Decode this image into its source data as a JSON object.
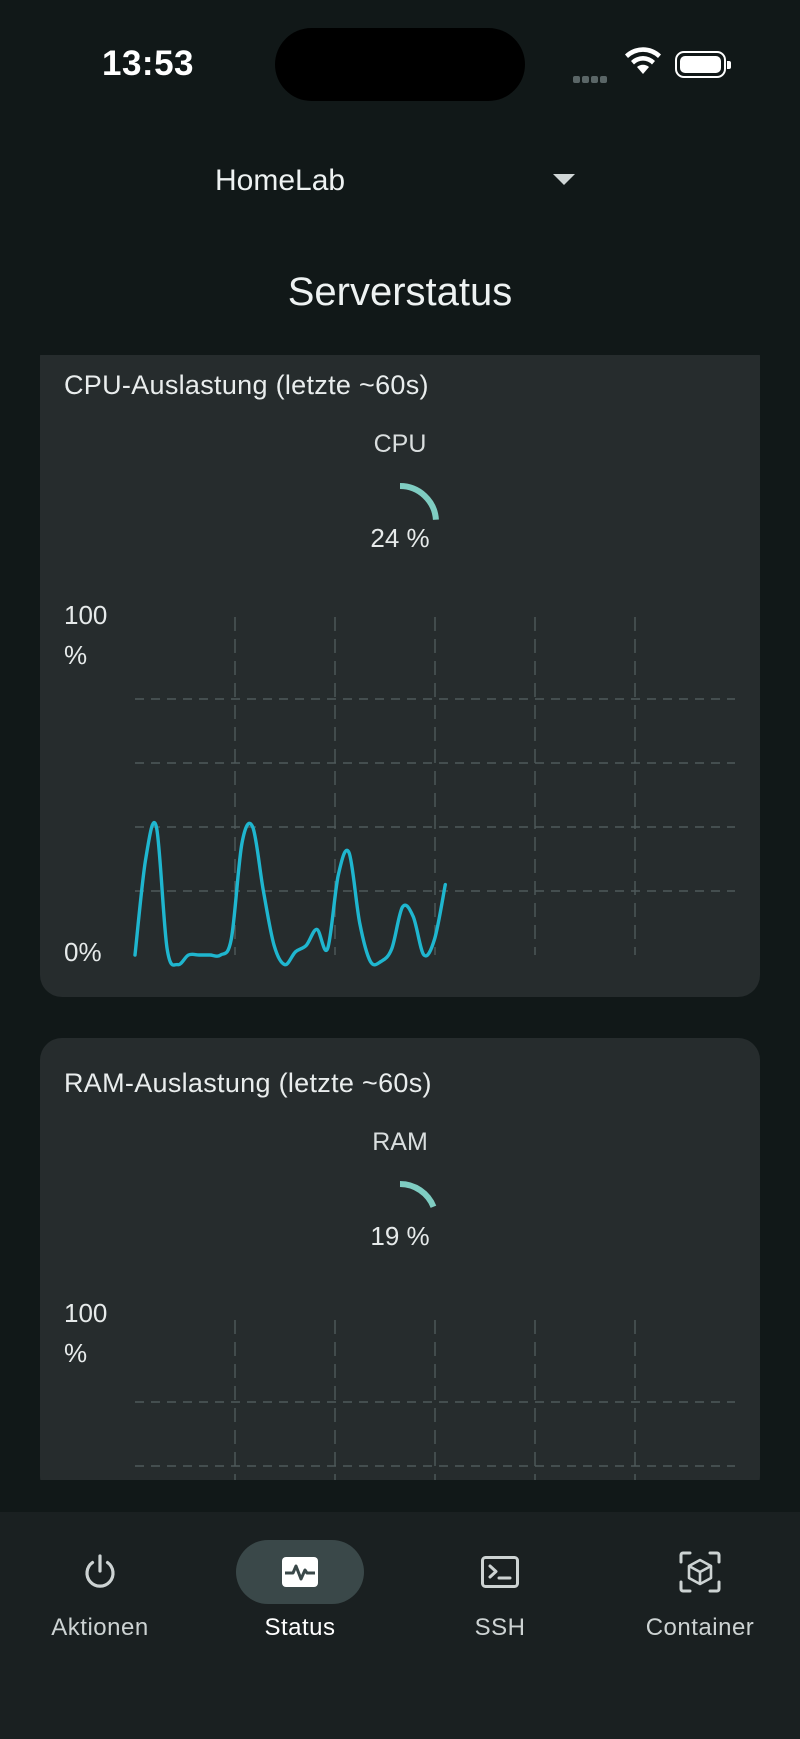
{
  "status_bar": {
    "time": "13:53"
  },
  "header": {
    "server_name": "HomeLab",
    "page_title": "Serverstatus"
  },
  "colors": {
    "accent": "#1fb6cf",
    "gauge": "#7fcdc2",
    "card": "#262c2d",
    "background": "#111818"
  },
  "cards": [
    {
      "title": "CPU-Auslastung (letzte ~60s)",
      "gauge_label": "CPU",
      "gauge_value": "24 %",
      "gauge_fraction": 0.24,
      "y_max_label": "100\n%",
      "y_min_label": "0%"
    },
    {
      "title": "RAM-Auslastung (letzte ~60s)",
      "gauge_label": "RAM",
      "gauge_value": "19 %",
      "gauge_fraction": 0.19,
      "y_max_label": "100\n%"
    }
  ],
  "chart_data": [
    {
      "type": "line",
      "title": "CPU-Auslastung (letzte ~60s)",
      "xlabel": "",
      "ylabel": "",
      "ylim": [
        0,
        100
      ],
      "y_tick_labels": [
        "0%",
        "100 %"
      ],
      "grid": true,
      "series": [
        {
          "values": [
            0,
            30,
            40,
            2,
            -3,
            0,
            0,
            0,
            0,
            5,
            35,
            40,
            20,
            3,
            -3,
            1,
            3,
            8,
            2,
            25,
            32,
            10,
            -2,
            -2,
            2,
            15,
            12,
            0,
            5,
            22
          ]
        }
      ]
    },
    {
      "type": "line",
      "title": "RAM-Auslastung (letzte ~60s)",
      "xlabel": "",
      "ylabel": "",
      "ylim": [
        0,
        100
      ],
      "y_tick_labels": [
        "100 %"
      ],
      "grid": true,
      "series": []
    }
  ],
  "nav": {
    "items": [
      {
        "label": "Aktionen",
        "icon": "power-icon"
      },
      {
        "label": "Status",
        "icon": "activity-icon"
      },
      {
        "label": "SSH",
        "icon": "terminal-icon"
      },
      {
        "label": "Container",
        "icon": "container-icon"
      }
    ],
    "active_index": 1
  }
}
